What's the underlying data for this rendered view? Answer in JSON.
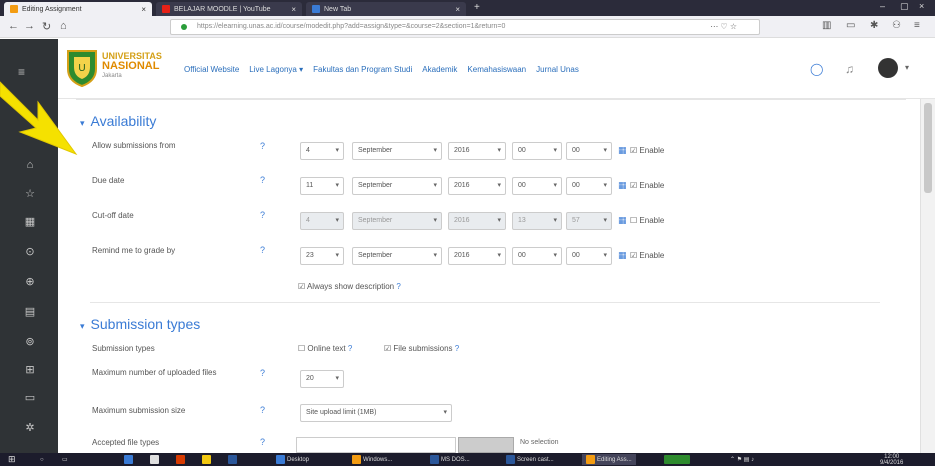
{
  "browser": {
    "tabs": [
      {
        "label": "Editing Assignment",
        "active": true
      },
      {
        "label": "BELAJAR MOODLE | YouTube",
        "active": false
      },
      {
        "label": "New Tab",
        "active": false
      }
    ],
    "url": "https://elearning.unas.ac.id/course/modedit.php?add=assign&type=&course=2&section=1&return=0",
    "zoom": "110%"
  },
  "header": {
    "university": {
      "line1": "UNIVERSITAS",
      "line2": "NASIONAL",
      "line3": "Jakarta"
    },
    "nav": [
      "Official Website",
      "Live Lagonya",
      "Fakultas dan Program Studi",
      "Akademik",
      "Kemahasiswaan",
      "Jurnal Unas"
    ],
    "nav_caret_index": 1
  },
  "availability": {
    "title": "Availability",
    "rows": [
      {
        "label": "Allow submissions from",
        "day": "4",
        "month": "September",
        "year": "2016",
        "hour": "00",
        "minute": "00",
        "enable": "Enable",
        "disabled": false,
        "checked": true
      },
      {
        "label": "Due date",
        "day": "11",
        "month": "September",
        "year": "2016",
        "hour": "00",
        "minute": "00",
        "enable": "Enable",
        "disabled": false,
        "checked": true
      },
      {
        "label": "Cut-off date",
        "day": "4",
        "month": "September",
        "year": "2016",
        "hour": "13",
        "minute": "57",
        "enable": "Enable",
        "disabled": true,
        "checked": false
      },
      {
        "label": "Remind me to grade by",
        "day": "23",
        "month": "September",
        "year": "2016",
        "hour": "00",
        "minute": "00",
        "enable": "Enable",
        "disabled": false,
        "checked": true
      }
    ],
    "always_show": "Always show description"
  },
  "submission_types": {
    "title": "Submission types",
    "types_label": "Submission types",
    "online_text": "Online text",
    "file_submissions": "File submissions",
    "max_files_label": "Maximum number of uploaded files",
    "max_files_value": "20",
    "max_size_label": "Maximum submission size",
    "max_size_value": "Site upload limit (1MB)",
    "accepted_label": "Accepted file types",
    "no_selection": "No selection"
  },
  "taskbar": {
    "items": [
      "Desktop",
      "Windows...",
      "MS DOS...",
      "Screen cast...",
      "Editing Ass..."
    ],
    "time": "12:00",
    "date": "9/4/2016"
  },
  "colors": {
    "accent": "#3a7bd5",
    "sidebar": "#2f3336",
    "arrow": "#f5e100"
  }
}
